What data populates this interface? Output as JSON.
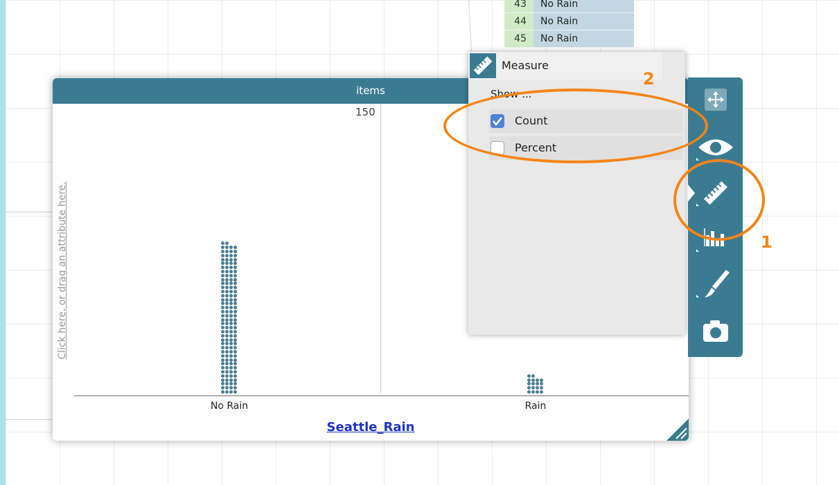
{
  "case_table": {
    "rows": [
      {
        "num": "43",
        "value": "No Rain"
      },
      {
        "num": "44",
        "value": "No Rain"
      },
      {
        "num": "45",
        "value": "No Rain"
      }
    ]
  },
  "graph": {
    "title": "items",
    "y_axis_hint": "Click here, or drag an attribute here.",
    "count_label": "150",
    "dataset_name": "Seattle_Rain"
  },
  "chart_data": {
    "type": "scatter",
    "categories": [
      "No Rain",
      "Rain"
    ],
    "values": [
      150,
      18
    ],
    "title": "items"
  },
  "measure_panel": {
    "title": "Measure",
    "show_label": "Show ...",
    "options": [
      {
        "label": "Count",
        "checked": true
      },
      {
        "label": "Percent",
        "checked": false
      }
    ]
  },
  "toolbar": {
    "tools": [
      "move-icon",
      "eye-icon",
      "ruler-icon",
      "bar-chart-icon",
      "brush-icon",
      "camera-icon"
    ]
  },
  "annotations": {
    "label_1": "1",
    "label_2": "2",
    "accent_color": "#f58417"
  },
  "colors": {
    "header": "#3b7b92",
    "dots": "#4a7f94",
    "link": "#1d34c5"
  }
}
